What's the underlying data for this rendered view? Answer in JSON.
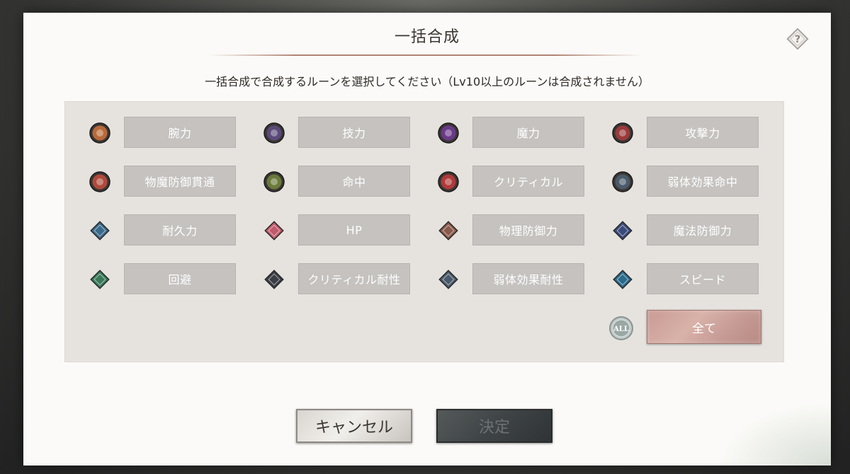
{
  "dialog": {
    "title": "一括合成",
    "instruction": "一括合成で合成するルーンを選択してください（Lv10以上のルーンは合成されません）"
  },
  "runes": [
    {
      "label": "腕力",
      "icon": "fist-rune-icon",
      "color": "#b86a3a"
    },
    {
      "label": "技力",
      "icon": "shield-emblem-rune-icon",
      "color": "#5a4a7a"
    },
    {
      "label": "魔力",
      "icon": "swirl-rune-icon",
      "color": "#6a3a8a"
    },
    {
      "label": "攻撃力",
      "icon": "sword-rune-icon",
      "color": "#9a3a3a"
    },
    {
      "label": "物魔防御貫通",
      "icon": "pierce-rune-icon",
      "color": "#b04a3a"
    },
    {
      "label": "命中",
      "icon": "target-rune-icon",
      "color": "#6a7a3a"
    },
    {
      "label": "クリティカル",
      "icon": "burst-rune-icon",
      "color": "#b03a3a"
    },
    {
      "label": "弱体効果命中",
      "icon": "skull-rune-icon",
      "color": "#4a5a6a"
    },
    {
      "label": "耐久力",
      "icon": "armor-rune-icon",
      "color": "#3a6a8a"
    },
    {
      "label": "HP",
      "icon": "heart-rune-icon",
      "color": "#c05a6a"
    },
    {
      "label": "物理防御力",
      "icon": "shield-rune-icon",
      "color": "#8a5a4a"
    },
    {
      "label": "魔法防御力",
      "icon": "wizard-hat-rune-icon",
      "color": "#3a4a7a"
    },
    {
      "label": "回避",
      "icon": "wind-rune-icon",
      "color": "#3a7a5a"
    },
    {
      "label": "クリティカル耐性",
      "icon": "guard-rune-icon",
      "color": "#3a3e44"
    },
    {
      "label": "弱体効果耐性",
      "icon": "cross-shield-rune-icon",
      "color": "#4a5a6a"
    },
    {
      "label": "スピード",
      "icon": "winged-boot-rune-icon",
      "color": "#2a6a8a"
    }
  ],
  "all_option": {
    "label": "全て",
    "icon_text": "ALL",
    "icon": "all-rune-icon"
  },
  "footer": {
    "cancel_label": "キャンセル",
    "confirm_label": "決定"
  },
  "colors": {
    "dialog_bg": "#fbfaf8",
    "rune_button_bg": "#c5c2bf",
    "all_button_bg": "#d2a8a0",
    "confirm_button_bg": "#44494b"
  }
}
